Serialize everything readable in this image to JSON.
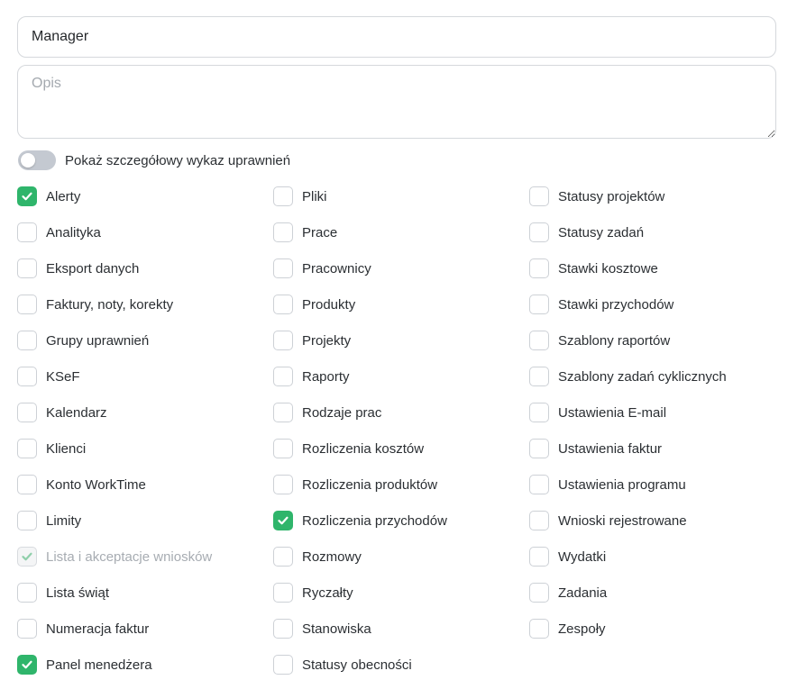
{
  "form": {
    "name_value": "Manager",
    "description_placeholder": "Opis",
    "description_value": ""
  },
  "toggle": {
    "label": "Pokaż szczegółowy wykaz uprawnień",
    "on": false
  },
  "colors": {
    "accent_green": "#2fb56b",
    "toggle_off": "#c4c9d1"
  },
  "permissions": {
    "columns": [
      [
        {
          "label": "Alerty",
          "state": "checked"
        },
        {
          "label": "Analityka",
          "state": "unchecked"
        },
        {
          "label": "Eksport danych",
          "state": "unchecked"
        },
        {
          "label": "Faktury, noty, korekty",
          "state": "unchecked"
        },
        {
          "label": "Grupy uprawnień",
          "state": "unchecked"
        },
        {
          "label": "KSeF",
          "state": "unchecked"
        },
        {
          "label": "Kalendarz",
          "state": "unchecked"
        },
        {
          "label": "Klienci",
          "state": "unchecked"
        },
        {
          "label": "Konto WorkTime",
          "state": "unchecked"
        },
        {
          "label": "Limity",
          "state": "unchecked"
        },
        {
          "label": "Lista i akceptacje wniosków",
          "state": "disabled-checked"
        },
        {
          "label": "Lista świąt",
          "state": "unchecked"
        },
        {
          "label": "Numeracja faktur",
          "state": "unchecked"
        },
        {
          "label": "Panel menedżera",
          "state": "checked"
        }
      ],
      [
        {
          "label": "Pliki",
          "state": "unchecked"
        },
        {
          "label": "Prace",
          "state": "unchecked"
        },
        {
          "label": "Pracownicy",
          "state": "unchecked"
        },
        {
          "label": "Produkty",
          "state": "unchecked"
        },
        {
          "label": "Projekty",
          "state": "unchecked"
        },
        {
          "label": "Raporty",
          "state": "unchecked"
        },
        {
          "label": "Rodzaje prac",
          "state": "unchecked"
        },
        {
          "label": "Rozliczenia kosztów",
          "state": "unchecked"
        },
        {
          "label": "Rozliczenia produktów",
          "state": "unchecked"
        },
        {
          "label": "Rozliczenia przychodów",
          "state": "checked"
        },
        {
          "label": "Rozmowy",
          "state": "unchecked"
        },
        {
          "label": "Ryczałty",
          "state": "unchecked"
        },
        {
          "label": "Stanowiska",
          "state": "unchecked"
        },
        {
          "label": "Statusy obecności",
          "state": "unchecked"
        }
      ],
      [
        {
          "label": "Statusy projektów",
          "state": "unchecked"
        },
        {
          "label": "Statusy zadań",
          "state": "unchecked"
        },
        {
          "label": "Stawki kosztowe",
          "state": "unchecked"
        },
        {
          "label": "Stawki przychodów",
          "state": "unchecked"
        },
        {
          "label": "Szablony raportów",
          "state": "unchecked"
        },
        {
          "label": "Szablony zadań cyklicznych",
          "state": "unchecked"
        },
        {
          "label": "Ustawienia E-mail",
          "state": "unchecked"
        },
        {
          "label": "Ustawienia faktur",
          "state": "unchecked"
        },
        {
          "label": "Ustawienia programu",
          "state": "unchecked"
        },
        {
          "label": "Wnioski rejestrowane",
          "state": "unchecked"
        },
        {
          "label": "Wydatki",
          "state": "unchecked"
        },
        {
          "label": "Zadania",
          "state": "unchecked"
        },
        {
          "label": "Zespoły",
          "state": "unchecked"
        }
      ]
    ]
  }
}
